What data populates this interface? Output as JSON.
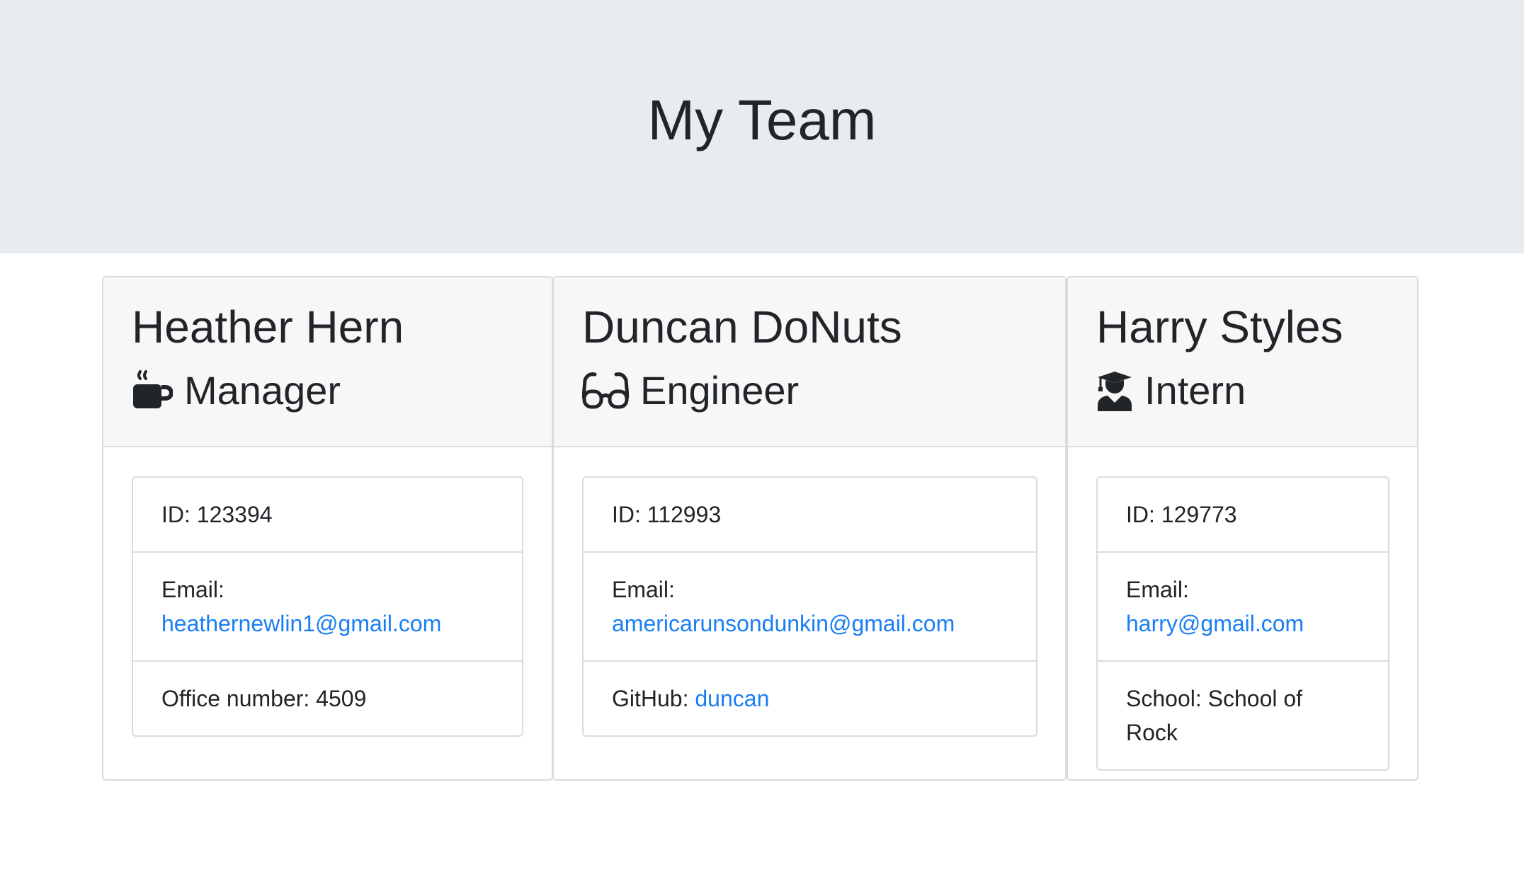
{
  "header": {
    "title": "My Team"
  },
  "colors": {
    "jumbotron_bg": "#e9ecef",
    "link": "#1a7ef3",
    "card_header_bg": "#f7f7f7"
  },
  "cards": [
    {
      "name": "Heather Hern",
      "role": "Manager",
      "role_icon": "coffee-mug-icon",
      "id_label": "ID: ",
      "id": "123394",
      "email_label": "Email:",
      "email": "heathernewlin1@gmail.com",
      "extra_label": "Office number: ",
      "extra_value": "4509"
    },
    {
      "name": "Duncan DoNuts",
      "role": "Engineer",
      "role_icon": "glasses-icon",
      "id_label": "ID: ",
      "id": "112993",
      "email_label": "Email:",
      "email": "americarunsondunkin@gmail.com",
      "extra_label": "GitHub: ",
      "extra_value": "duncan"
    },
    {
      "name": "Harry Styles",
      "role": "Intern",
      "role_icon": "graduate-icon",
      "id_label": "ID: ",
      "id": "129773",
      "email_label": "Email:",
      "email": "harry@gmail.com",
      "extra_label": "School: ",
      "extra_value": "School of Rock"
    }
  ]
}
